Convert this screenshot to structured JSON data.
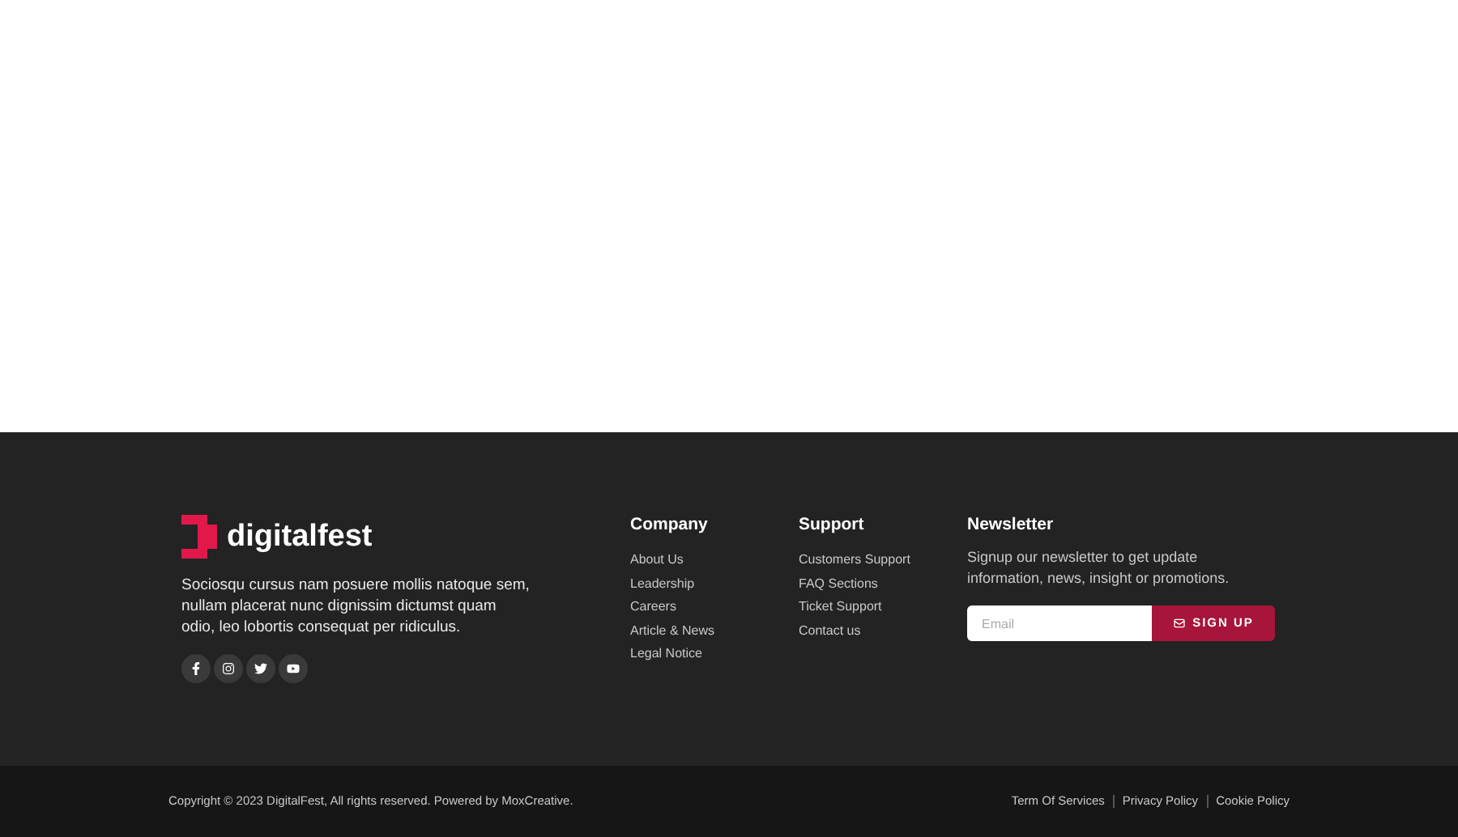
{
  "brand": {
    "name": "digitalfest",
    "description": "Sociosqu cursus nam posuere mollis natoque sem, nullam placerat nunc dignissim dictumst quam odio, leo lobortis consequat per ridiculus.",
    "social": [
      {
        "kind": "facebook"
      },
      {
        "kind": "instagram"
      },
      {
        "kind": "twitter"
      },
      {
        "kind": "youtube"
      }
    ]
  },
  "columns": [
    {
      "title": "Company",
      "links": [
        "About Us",
        "Leadership",
        "Careers",
        "Article & News",
        "Legal Notice"
      ]
    },
    {
      "title": "Support",
      "links": [
        "Customers Support",
        "FAQ Sections",
        "Ticket Support",
        "Contact us"
      ]
    }
  ],
  "newsletter": {
    "title": "Newsletter",
    "text": "Signup our newsletter to get update information, news, insight or promotions.",
    "placeholder": "Email",
    "button": "SIGN UP"
  },
  "bottom": {
    "copyright": "Copyright © 2023 DigitalFest, All rights reserved. Powered by MoxCreative.",
    "links": [
      "Term Of Services",
      "Privacy Policy",
      "Cookie Policy"
    ]
  }
}
